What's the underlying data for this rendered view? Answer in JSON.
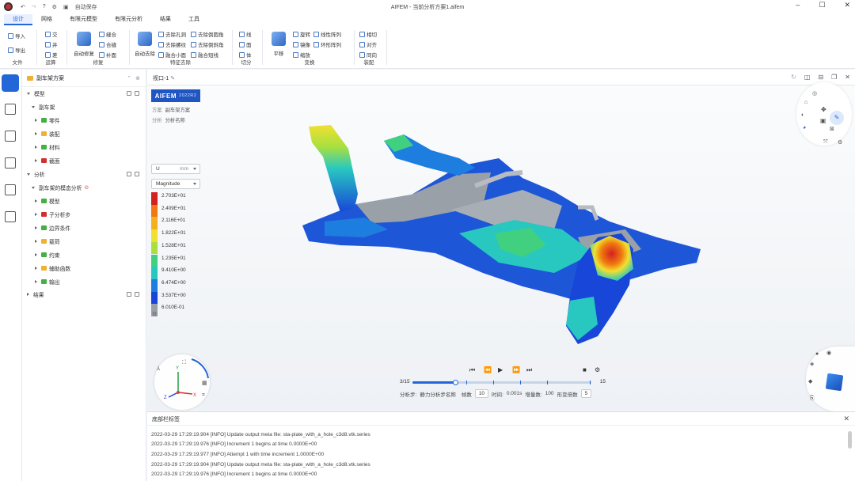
{
  "app": {
    "autosave": "自动保存",
    "title": "AIFEM - 当前分析方案1.aifem"
  },
  "menu": {
    "tabs": [
      "设计",
      "网格",
      "有限元模型",
      "有限元分析",
      "结果",
      "工具"
    ],
    "active": 0
  },
  "ribbon": {
    "file": {
      "import": "导入",
      "export": "导出",
      "label": "文件"
    },
    "ops": {
      "items": [
        "交",
        "并",
        "差"
      ],
      "label": "运算"
    },
    "repair": {
      "auto": "自动修复",
      "items": [
        "缝合",
        "合缝",
        "补面"
      ],
      "label": "修复"
    },
    "feature": {
      "auto": "自动去除",
      "col1": [
        "去除孔洞",
        "去除螺纹",
        "融合小面"
      ],
      "col2": [
        "去除倒圆角",
        "去除倒斜角",
        "融合短线"
      ],
      "label": "特征去除"
    },
    "cut": {
      "items": [
        "线",
        "面",
        "体"
      ],
      "label": "切分"
    },
    "transform": {
      "move": "平移",
      "col1": [
        "旋转",
        "镜像",
        "缩放"
      ],
      "col2": [
        "线性阵列",
        "环形阵列"
      ],
      "label": "变换"
    },
    "assembly": {
      "items": [
        "相切",
        "对齐",
        "同向"
      ],
      "label": "装配"
    }
  },
  "tree": {
    "root": "副车架方案",
    "model_section": "模型",
    "model_node": "副车架",
    "model_children": [
      "零件",
      "装配",
      "材料",
      "截面"
    ],
    "analysis_section": "分析",
    "analysis_node": "副车架的模态分析",
    "analysis_children": [
      "模型",
      "子分析步",
      "边界条件",
      "载荷",
      "约束",
      "辅助函数",
      "输出"
    ],
    "results": "结果"
  },
  "viewport": {
    "tab": "视口-1",
    "badge_brand": "AIFEM",
    "badge_version": "2022R2",
    "scheme_label": "方案",
    "scheme_value": "副车架方案",
    "analysis_label": "分析",
    "analysis_value": "分析名称",
    "var": "U",
    "unit": "mm",
    "component": "Magnitude"
  },
  "legend": {
    "labels": [
      "2.703E+01",
      "2.409E+01",
      "2.116E+01",
      "1.822E+01",
      "1.528E+01",
      "1.235E+01",
      "9.410E+00",
      "6.474E+00",
      "3.537E+00",
      "6.010E-01"
    ],
    "colors": [
      "#d42020",
      "#f07a10",
      "#f5b020",
      "#f0e030",
      "#a8e040",
      "#40d080",
      "#28c8c0",
      "#1e7ee0",
      "#1846d8",
      "#9aa0a8"
    ]
  },
  "player": {
    "frame_current": "3/15",
    "frame_end": "15",
    "progress": 0.24,
    "step_label": "分析步:",
    "step_value": "静力分析步名称",
    "frames_label": "帧数",
    "frames_value": "10",
    "time_label": "时间:",
    "time_value": "0.001s",
    "inc_label": "增量数:",
    "inc_value": "100",
    "deform_label": "形变倍数",
    "deform_value": "5"
  },
  "console": {
    "title": "底部栏标签",
    "lines": [
      "2022-03-29 17:29:19.904 [INFO] Update output meta file: sta-plate_with_a_hole_c3d8.vtk.series",
      "2022-03-29 17:29:19.976 [INFO] Increment 1 begins at time 0.0000E+00",
      "2022-03-29 17:29:19.977 [INFO] Attempt 1 with time increment 1.0000E+00",
      "2022-03-29 17:29:19.904 [INFO] Update output meta file: sta-plate_with_a_hole_c3d8.vtk.series",
      "2022-03-29 17:29:19.976 [INFO] Increment 1 begins at time 0.0000E+00"
    ]
  },
  "gizmo": {
    "x": "X",
    "y": "Y",
    "z": "Z"
  }
}
